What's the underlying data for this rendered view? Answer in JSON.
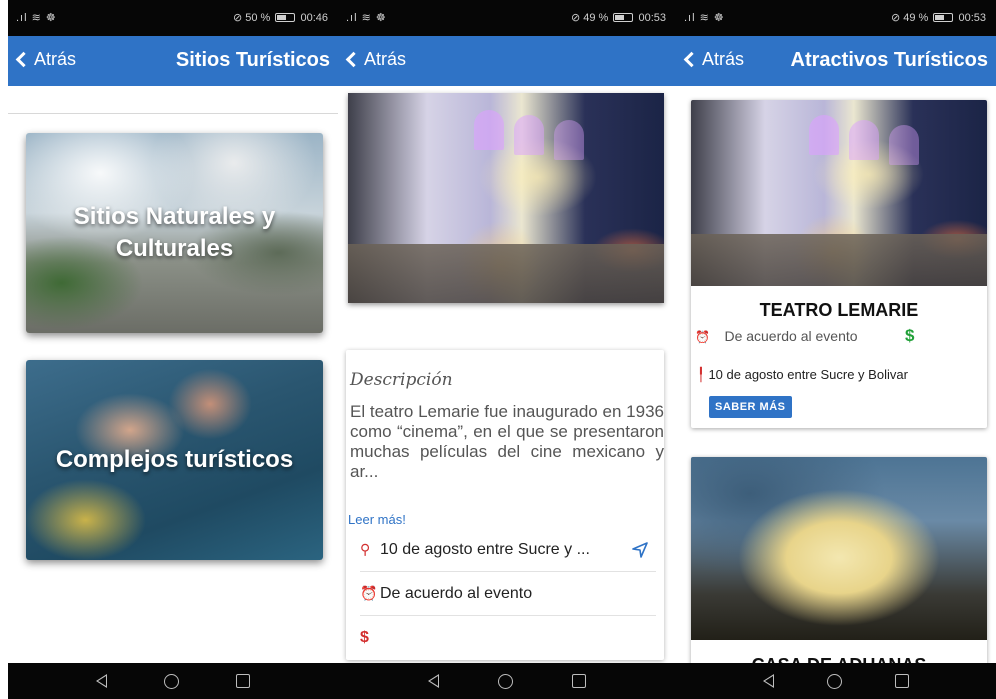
{
  "screens": [
    {
      "status": {
        "signal": ".ıl ≋ ☸",
        "battery": "50 %",
        "time": "00:46"
      },
      "back_label": "Atrás",
      "title": "Sitios Turísticos",
      "tiles": [
        {
          "label": "Sitios Naturales y Culturales"
        },
        {
          "label": "Complejos turísticos"
        }
      ]
    },
    {
      "status": {
        "signal": ".ıl ≋ ☸",
        "battery": "49 %",
        "time": "00:53"
      },
      "back_label": "Atrás",
      "description": {
        "heading": "Descripción",
        "body": "El teatro Lemarie fue inaugurado en 1936 como “cinema”, en el que se presentaron muchas películas del cine mexicano y ar...",
        "read_more": "Leer más!",
        "address": "10 de agosto entre Sucre y ...",
        "schedule": "De acuerdo al evento",
        "price": "$"
      }
    },
    {
      "status": {
        "signal": ".ıl ≋ ☸",
        "battery": "49 %",
        "time": "00:53"
      },
      "back_label": "Atrás",
      "title": "Atractivos Turísticos",
      "cards": [
        {
          "name": "TEATRO LEMARIE",
          "schedule": "De acuerdo al evento",
          "price": "$",
          "address": "10 de agosto entre Sucre y Bolivar",
          "button": "SABER MÁS"
        },
        {
          "name": "CASA DE ADUANAS"
        }
      ]
    }
  ],
  "colors": {
    "appbar": "#2f73c6",
    "price_green": "#21a038",
    "pin_red": "#d32f2f",
    "clock_yellow": "#f4c430"
  }
}
